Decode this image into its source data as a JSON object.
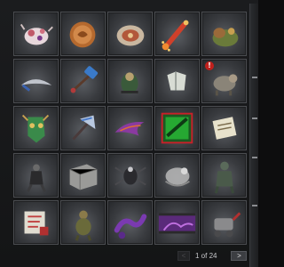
{
  "pager": {
    "prev_label": "<",
    "page_text": "1 of 24",
    "next_label": ">"
  },
  "items": [
    {
      "icon": "decorated-head-gear-icon"
    },
    {
      "icon": "bronze-coin-icon"
    },
    {
      "icon": "ornate-shield-icon"
    },
    {
      "icon": "firecracker-icon"
    },
    {
      "icon": "treasure-creature-icon"
    },
    {
      "icon": "curved-blade-icon"
    },
    {
      "icon": "blue-hammer-icon"
    },
    {
      "icon": "courier-creature-icon"
    },
    {
      "icon": "stone-armor-icon"
    },
    {
      "icon": "armored-hound-icon",
      "new": "!"
    },
    {
      "icon": "tribal-mask-icon"
    },
    {
      "icon": "steel-axe-icon"
    },
    {
      "icon": "purple-wing-icon"
    },
    {
      "icon": "dota-logo-icon"
    },
    {
      "icon": "scroll-icon"
    },
    {
      "icon": "dark-hero-icon"
    },
    {
      "icon": "stone-block-icon"
    },
    {
      "icon": "spider-creature-icon"
    },
    {
      "icon": "ghostly-creature-icon"
    },
    {
      "icon": "armored-knight-icon"
    },
    {
      "icon": "treasure-map-icon"
    },
    {
      "icon": "ogre-figure-icon"
    },
    {
      "icon": "purple-tentacle-icon"
    },
    {
      "icon": "loading-screen-icon"
    },
    {
      "icon": "mechanical-courier-icon"
    }
  ]
}
